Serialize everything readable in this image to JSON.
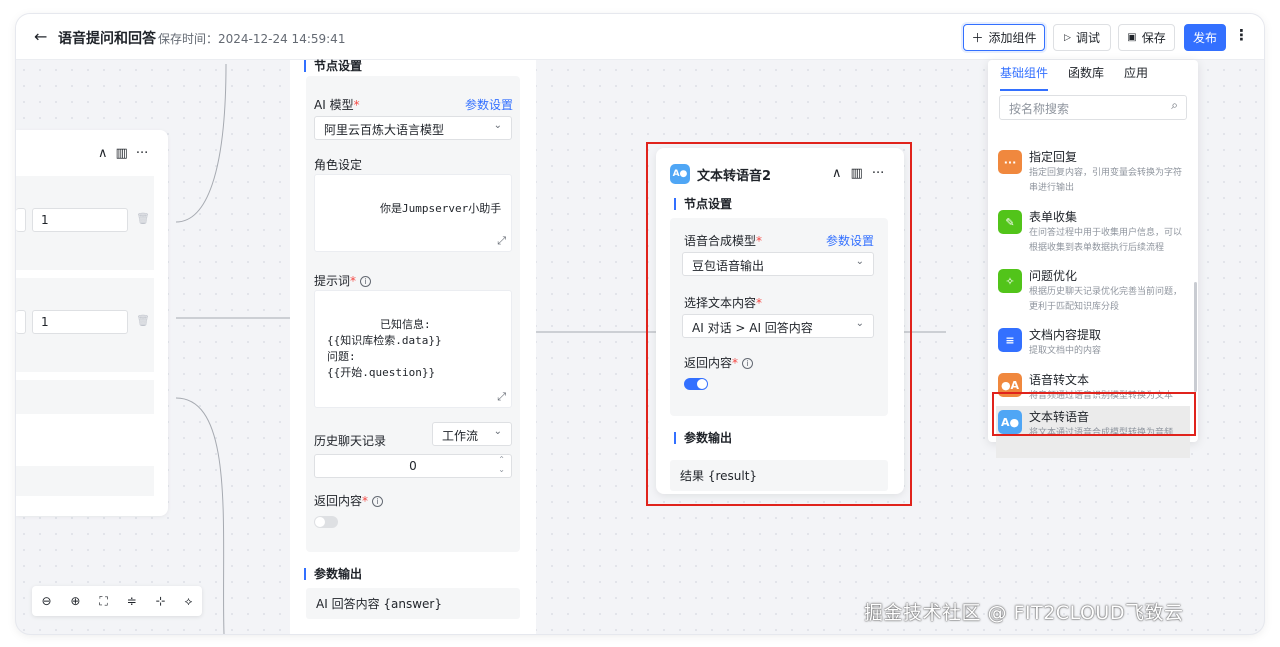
{
  "header": {
    "back_icon": "arrow-left-icon",
    "title": "语音提问和回答",
    "save_time": "保存时间：2024-12-24 14:59:41",
    "add_component": "添加组件",
    "debug": "调试",
    "save": "保存",
    "publish": "发布"
  },
  "left_node": {
    "row1_value": "1",
    "row2_value": "1"
  },
  "ai_node": {
    "section_node_settings": "节点设置",
    "ai_model_label": "AI 模型",
    "param_settings": "参数设置",
    "ai_model_value": "阿里云百炼大语言模型",
    "role_label": "角色设定",
    "role_value": "你是Jumpserver小助手",
    "prompt_label": "提示词",
    "prompt_value": "已知信息:\n{{知识库检索.data}}\n问题:\n{{开始.question}}",
    "history_label": "历史聊天记录",
    "history_source": "工作流",
    "history_count": "0",
    "return_label": "返回内容",
    "return_enabled": false,
    "section_output": "参数输出",
    "output_value": "AI 回答内容 {answer}"
  },
  "tts_node": {
    "title": "文本转语音2",
    "section_node_settings": "节点设置",
    "model_label": "语音合成模型",
    "param_settings": "参数设置",
    "model_value": "豆包语音输出",
    "text_label": "选择文本内容",
    "text_value": "AI 对话 > AI 回答内容",
    "return_label": "返回内容",
    "return_enabled": true,
    "section_output": "参数输出",
    "output_value": "结果 {result}",
    "accent_color": "#3370ff"
  },
  "panel": {
    "tabs": [
      "基础组件",
      "函数库",
      "应用"
    ],
    "search_placeholder": "按名称搜索",
    "components": [
      {
        "title": "指定回复",
        "desc": "指定回复内容，引用变量会转换为字符串进行输出",
        "icon": "chat-bubble-icon",
        "color": "#f0883e",
        "glyph": "···"
      },
      {
        "title": "表单收集",
        "desc": "在问答过程中用于收集用户信息，可以根据收集到表单数据执行后续流程",
        "icon": "form-icon",
        "color": "#52c41a",
        "glyph": "✎"
      },
      {
        "title": "问题优化",
        "desc": "根据历史聊天记录优化完善当前问题，更利于匹配知识库分段",
        "icon": "wrench-icon",
        "color": "#52c41a",
        "glyph": "✧"
      },
      {
        "title": "文档内容提取",
        "desc": "提取文档中的内容",
        "icon": "document-icon",
        "color": "#3370ff",
        "glyph": "≡"
      },
      {
        "title": "语音转文本",
        "desc": "将音频通过语音识别模型转换为文本",
        "icon": "speech-to-text-icon",
        "color": "#f0883e",
        "glyph": "●A"
      },
      {
        "title": "文本转语音",
        "desc": "将文本通过语音合成模型转换为音频",
        "icon": "text-to-speech-icon",
        "color": "#4fa6f5",
        "glyph": "A●"
      }
    ]
  },
  "watermark": "掘金技术社区 @ FIT2CLOUD飞致云"
}
